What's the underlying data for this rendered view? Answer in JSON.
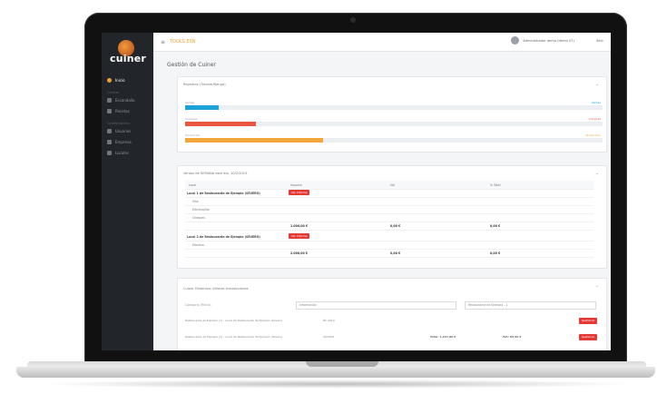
{
  "sidebar": {
    "logo_text": "cuiner",
    "items": [
      {
        "label": "Inicio",
        "active": true
      },
      {
        "header": "Control"
      },
      {
        "label": "Escandallo"
      },
      {
        "label": "Recetas"
      },
      {
        "header": "Configuración"
      },
      {
        "label": "Usuarios"
      },
      {
        "label": "Empresa"
      },
      {
        "label": "Locales"
      }
    ]
  },
  "topbar": {
    "title": "TOOLS ESN",
    "user_name": "Administrador demo (demo V7)",
    "logout_label": "Salir"
  },
  "page": {
    "title": "Gestión de Cuiner"
  },
  "progress_panel": {
    "title": "Registros (Tutorial/Nanga)",
    "bars": [
      {
        "label": "Ventas",
        "right": "Ventas",
        "value": 8,
        "color": "#1aa3d6"
      },
      {
        "label": "Compras",
        "right": "Compras",
        "value": 17,
        "color": "#e9573f"
      },
      {
        "label": "Producción",
        "right": "Producción",
        "value": 33,
        "color": "#f2a53a"
      }
    ]
  },
  "table_panel": {
    "title": "Ventas de SEMANA este día, 10/2/2019",
    "headers": [
      "Local",
      "Importe",
      "IVA",
      "% Total"
    ],
    "section1": {
      "title": "Local 1 de Restaurante de Ejemplo (SEVERO)",
      "badge": "Ver informe",
      "rows": [
        "Visa",
        "Efectivo/Var",
        "Cheques"
      ],
      "totals": [
        "1.000,00 €",
        "0,00 €",
        "0,00 €"
      ]
    },
    "section2": {
      "title": "Local 2 de Restaurante de Ejemplo (SEVERO)",
      "badge": "Ver informe",
      "rows": [
        "Efectivo"
      ],
      "totals": [
        "2.000,00 €",
        "0,00 €",
        "0,00 €"
      ]
    }
  },
  "bottom_panel": {
    "title": "Cuiner Dinámico: últimas transacciones",
    "filter_label": "Categoría (Filtros)",
    "select1": "Información",
    "select2": "Restaurante de Ejemplo - 1",
    "rows": [
      {
        "text": "Restaurante de Ejemplo (1) - Local de Restaurante de Ejemplo (Severo)",
        "code": "RC-2019",
        "btn": "Gestionar"
      },
      {
        "text": "Restaurante de Ejemplo (1) - Local de Restaurante de Ejemplo (Severo)",
        "code": "42/3001",
        "amount1": "Total: 1.227,00 €",
        "amount2": "IVA: 82,50 €",
        "btn": "Gestionar"
      }
    ]
  }
}
